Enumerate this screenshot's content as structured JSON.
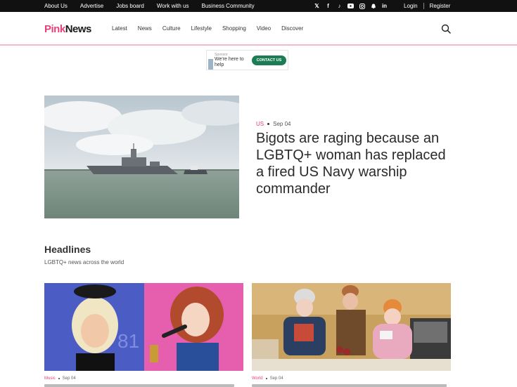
{
  "topbar": {
    "links": [
      "About Us",
      "Advertise",
      "Jobs board",
      "Work with us",
      "Business Community"
    ],
    "social_icons": [
      "x-icon",
      "facebook-icon",
      "tiktok-icon",
      "youtube-icon",
      "instagram-icon",
      "snapchat-icon",
      "linkedin-icon"
    ],
    "login": "Login",
    "register": "Register"
  },
  "header": {
    "logo_pink": "Pink",
    "logo_dark": "News",
    "nav": [
      "Latest",
      "News",
      "Culture",
      "Lifestyle",
      "Shopping",
      "Video",
      "Discover"
    ]
  },
  "ad": {
    "sponsor": "Sponsor",
    "text": "We're here to help",
    "button": "CONTACT US"
  },
  "hero": {
    "category": "US",
    "date": "Sep 04",
    "title": "Bigots are raging because an LGBTQ+ woman has replaced a fired US Navy warship commander"
  },
  "headlines": {
    "title": "Headlines",
    "subtitle": "LGBTQ+ news across the world",
    "cards": [
      {
        "category": "Music",
        "date": "Sep 04"
      },
      {
        "category": "World",
        "date": "Sep 04"
      }
    ]
  },
  "colors": {
    "brand_pink": "#e8417a",
    "ad_button": "#1c7c54"
  }
}
